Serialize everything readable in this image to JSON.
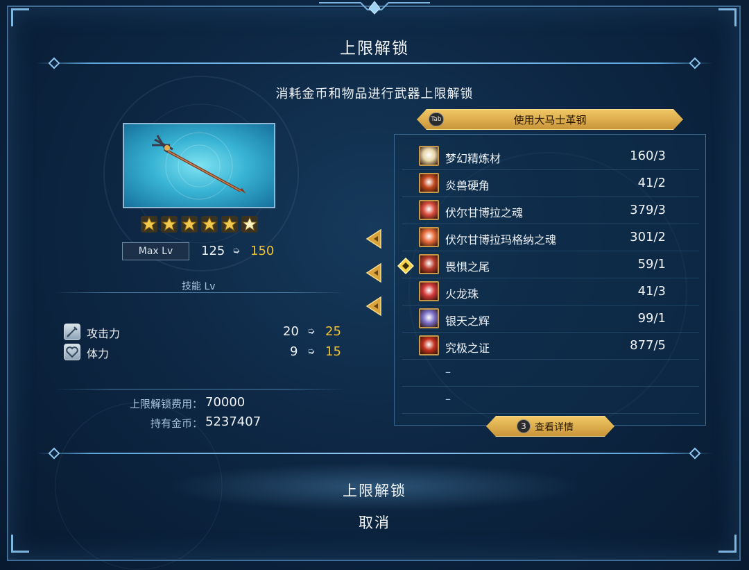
{
  "title": "上限解锁",
  "subtitle": "消耗金币和物品进行武器上限解锁",
  "weapon": {
    "icon": "trident-spear",
    "rarity_stars": 6,
    "max_lv_label": "Max Lv",
    "max_lv_from": "125",
    "max_lv_to": "150",
    "arrow": "➭"
  },
  "skill_section_label": "技能 Lv",
  "stats": [
    {
      "icon": "sword-icon",
      "name": "攻击力",
      "from": "20",
      "to": "25"
    },
    {
      "icon": "heart-icon",
      "name": "体力",
      "from": "9",
      "to": "15"
    }
  ],
  "cost": {
    "unlock_cost_label": "上限解锁费用：",
    "unlock_cost_value": "70000",
    "gold_held_label": "持有金币：",
    "gold_held_value": "5237407"
  },
  "materials_tab": {
    "badge": "Tab",
    "label": "使用大马士革钢"
  },
  "materials": [
    {
      "name": "梦幻精炼材",
      "count": "160/3",
      "icon": "crest-icon",
      "color": "#e8d6a8"
    },
    {
      "name": "炎兽硬角",
      "count": "41/2",
      "icon": "horn-icon",
      "color": "#c2471d"
    },
    {
      "name": "伏尔甘博拉之魂",
      "count": "379/3",
      "icon": "soul-orb-icon",
      "color": "#d84b3c"
    },
    {
      "name": "伏尔甘博拉玛格纳之魂",
      "count": "301/2",
      "icon": "magna-soul-icon",
      "color": "#e86a3a"
    },
    {
      "name": "畏惧之尾",
      "count": "59/1",
      "icon": "tail-icon",
      "color": "#b83a2a"
    },
    {
      "name": "火龙珠",
      "count": "41/3",
      "icon": "dragon-orb-icon",
      "color": "#d23838"
    },
    {
      "name": "银天之辉",
      "count": "99/1",
      "icon": "silver-radiance-icon",
      "color": "#7a6fc8"
    },
    {
      "name": "究极之证",
      "count": "877/5",
      "icon": "ultimate-proof-icon",
      "color": "#c22f1c"
    }
  ],
  "empty_slots": [
    "–",
    "–"
  ],
  "detail_button": {
    "badge": "3",
    "label": "查看详情"
  },
  "confirm_label": "上限解锁",
  "cancel_label": "取消",
  "colors": {
    "accent_gold": "#f2c230",
    "frame_blue": "#3f6f99"
  }
}
